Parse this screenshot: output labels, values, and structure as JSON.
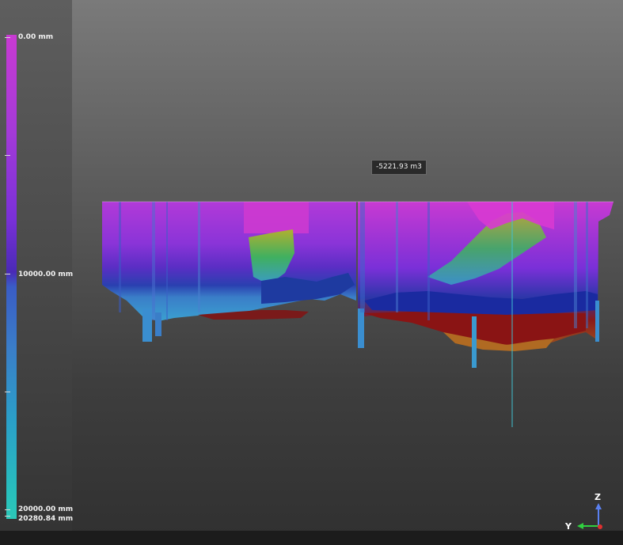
{
  "legend": {
    "labels": [
      "0.00 mm",
      "10000.00 mm",
      "20000.00 mm",
      "20280.84 mm"
    ],
    "gradient_colors": [
      "#c83ad2",
      "#7a30d8",
      "#4a2ab6",
      "#3a7ec8",
      "#28c0bc"
    ]
  },
  "tooltip": {
    "text": "-5221.93 m3"
  },
  "axes": {
    "z_label": "Z",
    "y_label": "Y"
  },
  "colors": {
    "x_axis": "#e03030",
    "y_axis": "#30d040",
    "z_axis": "#5a80f0",
    "background_top": "#7a7a7a",
    "background_bottom": "#303030"
  }
}
